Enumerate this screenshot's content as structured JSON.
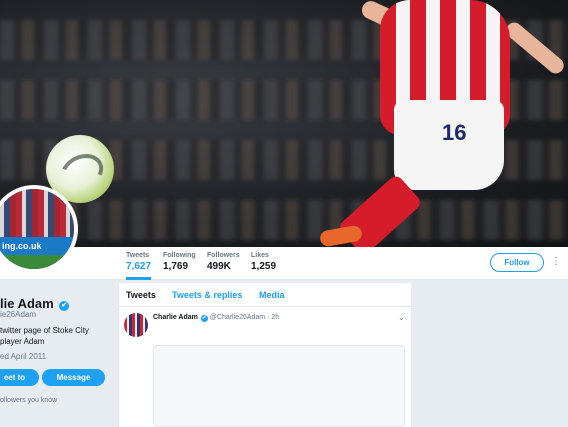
{
  "nav": {
    "stats": [
      {
        "label": "Tweets",
        "value": "7,627"
      },
      {
        "label": "Following",
        "value": "1,769"
      },
      {
        "label": "Followers",
        "value": "499K"
      },
      {
        "label": "Likes",
        "value": "1,259"
      }
    ],
    "follow_label": "Follow",
    "more_glyph": "⋮"
  },
  "avatar": {
    "board_text": "ing.co.uk"
  },
  "profile": {
    "name": "lie Adam",
    "verified_glyph": "✔",
    "handle": "ie26Adam",
    "bio": "twitter page of Stoke City player Adam",
    "joined": "ed April 2011",
    "tweet_to_label": "eet to",
    "message_label": "Message",
    "followers_you_know": "ollowers you know"
  },
  "timeline": {
    "tabs": [
      "Tweets",
      "Tweets & replies",
      "Media"
    ],
    "tweet": {
      "name": "Charlie Adam",
      "handle": "@Charlie26Adam",
      "time": "· 2h",
      "caret": "⌄"
    }
  },
  "header": {
    "shirt_number": "16"
  },
  "colors": {
    "accent": "#1da1f2",
    "text": "#14171a",
    "muted": "#657786",
    "background": "#e6ecf0"
  }
}
